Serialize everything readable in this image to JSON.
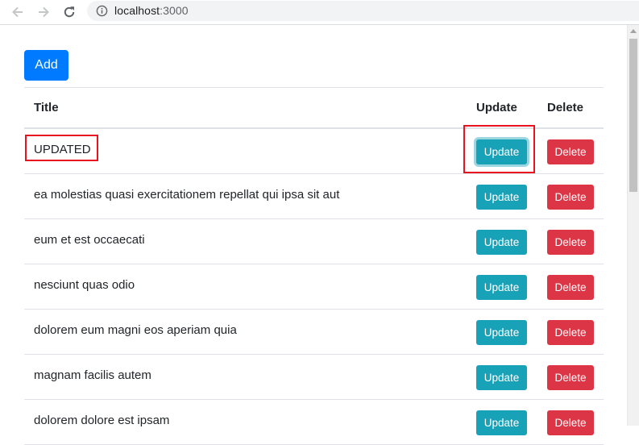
{
  "browser": {
    "url_host": "localhost",
    "url_port": ":3000"
  },
  "page": {
    "add_label": "Add",
    "headers": {
      "title": "Title",
      "update": "Update",
      "delete": "Delete"
    },
    "update_label": "Update",
    "delete_label": "Delete",
    "rows": [
      {
        "title": "UPDATED"
      },
      {
        "title": "ea molestias quasi exercitationem repellat qui ipsa sit aut"
      },
      {
        "title": "eum et est occaecati"
      },
      {
        "title": "nesciunt quas odio"
      },
      {
        "title": "dolorem eum magni eos aperiam quia"
      },
      {
        "title": "magnam facilis autem"
      },
      {
        "title": "dolorem dolore est ipsam"
      }
    ]
  },
  "colors": {
    "primary": "#007bff",
    "info": "#17a2b8",
    "danger": "#dc3545",
    "annotation": "#e8131f"
  }
}
